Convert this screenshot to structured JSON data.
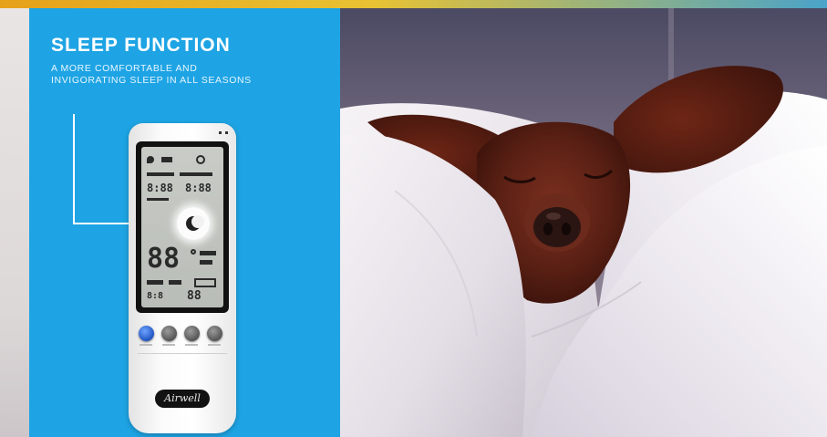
{
  "panel": {
    "title": "SLEEP FUNCTION",
    "subtitle_line1": "A MORE COMFORTABLE AND",
    "subtitle_line2": "INVIGORATING SLEEP IN ALL SEASONS",
    "background_color": "#1ea4e4"
  },
  "remote": {
    "brand": "Airwell",
    "display_temp": "88",
    "buttons": [
      "power-button",
      "mode-button",
      "fan-button",
      "sleep-button"
    ]
  },
  "photo": {
    "subject": "dachshund sleeping in white pillows"
  },
  "colors": {
    "accent_blue": "#1ea4e4",
    "top_bar_gold": "#e6a11a",
    "top_bar_teal": "#4aa3c9"
  }
}
